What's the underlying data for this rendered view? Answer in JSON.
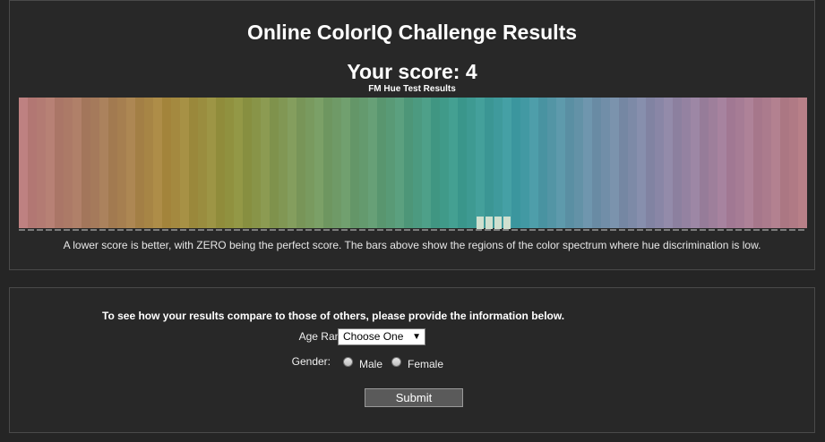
{
  "results": {
    "title": "Online ColorIQ Challenge Results",
    "score_text": "Your score: 4",
    "chart_caption": "FM Hue Test Results",
    "explanation": "A lower score is better, with ZERO being the perfect score. The bars above show the regions of the color spectrum where hue discrimination is low."
  },
  "spectrum": {
    "colors": [
      "#b87b7b",
      "#a57a5b",
      "#a8883f",
      "#8e923f",
      "#7a9a5e",
      "#5f9a72",
      "#3e9a8a",
      "#3f9aa3",
      "#6a90a8",
      "#8a86a6",
      "#a57c97",
      "#b27a82"
    ],
    "band_count": 88,
    "error_bar_count": 4,
    "error_bar_color": "#cfe0cf"
  },
  "form": {
    "prompt": "To see how your results compare to those of others, please provide the information below.",
    "age_label": "Age Range:",
    "age_selected": "Choose One",
    "gender_label": "Gender:",
    "male_label": "Male",
    "female_label": "Female",
    "submit_label": "Submit"
  }
}
